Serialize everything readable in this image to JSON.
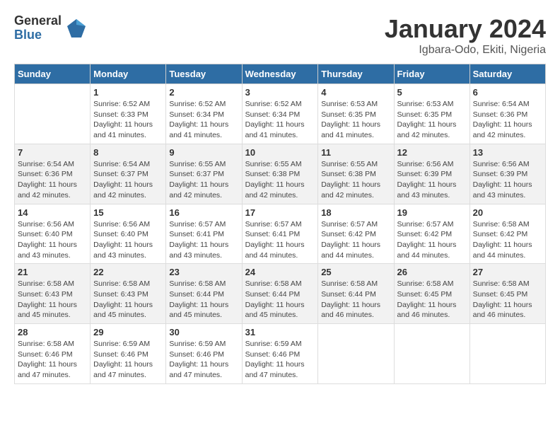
{
  "logo": {
    "general": "General",
    "blue": "Blue"
  },
  "title": "January 2024",
  "subtitle": "Igbara-Odo, Ekiti, Nigeria",
  "days_header": [
    "Sunday",
    "Monday",
    "Tuesday",
    "Wednesday",
    "Thursday",
    "Friday",
    "Saturday"
  ],
  "weeks": [
    [
      {
        "day": "",
        "sunrise": "",
        "sunset": "",
        "daylight": ""
      },
      {
        "day": "1",
        "sunrise": "Sunrise: 6:52 AM",
        "sunset": "Sunset: 6:33 PM",
        "daylight": "Daylight: 11 hours and 41 minutes."
      },
      {
        "day": "2",
        "sunrise": "Sunrise: 6:52 AM",
        "sunset": "Sunset: 6:34 PM",
        "daylight": "Daylight: 11 hours and 41 minutes."
      },
      {
        "day": "3",
        "sunrise": "Sunrise: 6:52 AM",
        "sunset": "Sunset: 6:34 PM",
        "daylight": "Daylight: 11 hours and 41 minutes."
      },
      {
        "day": "4",
        "sunrise": "Sunrise: 6:53 AM",
        "sunset": "Sunset: 6:35 PM",
        "daylight": "Daylight: 11 hours and 41 minutes."
      },
      {
        "day": "5",
        "sunrise": "Sunrise: 6:53 AM",
        "sunset": "Sunset: 6:35 PM",
        "daylight": "Daylight: 11 hours and 42 minutes."
      },
      {
        "day": "6",
        "sunrise": "Sunrise: 6:54 AM",
        "sunset": "Sunset: 6:36 PM",
        "daylight": "Daylight: 11 hours and 42 minutes."
      }
    ],
    [
      {
        "day": "7",
        "sunrise": "Sunrise: 6:54 AM",
        "sunset": "Sunset: 6:36 PM",
        "daylight": "Daylight: 11 hours and 42 minutes."
      },
      {
        "day": "8",
        "sunrise": "Sunrise: 6:54 AM",
        "sunset": "Sunset: 6:37 PM",
        "daylight": "Daylight: 11 hours and 42 minutes."
      },
      {
        "day": "9",
        "sunrise": "Sunrise: 6:55 AM",
        "sunset": "Sunset: 6:37 PM",
        "daylight": "Daylight: 11 hours and 42 minutes."
      },
      {
        "day": "10",
        "sunrise": "Sunrise: 6:55 AM",
        "sunset": "Sunset: 6:38 PM",
        "daylight": "Daylight: 11 hours and 42 minutes."
      },
      {
        "day": "11",
        "sunrise": "Sunrise: 6:55 AM",
        "sunset": "Sunset: 6:38 PM",
        "daylight": "Daylight: 11 hours and 42 minutes."
      },
      {
        "day": "12",
        "sunrise": "Sunrise: 6:56 AM",
        "sunset": "Sunset: 6:39 PM",
        "daylight": "Daylight: 11 hours and 43 minutes."
      },
      {
        "day": "13",
        "sunrise": "Sunrise: 6:56 AM",
        "sunset": "Sunset: 6:39 PM",
        "daylight": "Daylight: 11 hours and 43 minutes."
      }
    ],
    [
      {
        "day": "14",
        "sunrise": "Sunrise: 6:56 AM",
        "sunset": "Sunset: 6:40 PM",
        "daylight": "Daylight: 11 hours and 43 minutes."
      },
      {
        "day": "15",
        "sunrise": "Sunrise: 6:56 AM",
        "sunset": "Sunset: 6:40 PM",
        "daylight": "Daylight: 11 hours and 43 minutes."
      },
      {
        "day": "16",
        "sunrise": "Sunrise: 6:57 AM",
        "sunset": "Sunset: 6:41 PM",
        "daylight": "Daylight: 11 hours and 43 minutes."
      },
      {
        "day": "17",
        "sunrise": "Sunrise: 6:57 AM",
        "sunset": "Sunset: 6:41 PM",
        "daylight": "Daylight: 11 hours and 44 minutes."
      },
      {
        "day": "18",
        "sunrise": "Sunrise: 6:57 AM",
        "sunset": "Sunset: 6:42 PM",
        "daylight": "Daylight: 11 hours and 44 minutes."
      },
      {
        "day": "19",
        "sunrise": "Sunrise: 6:57 AM",
        "sunset": "Sunset: 6:42 PM",
        "daylight": "Daylight: 11 hours and 44 minutes."
      },
      {
        "day": "20",
        "sunrise": "Sunrise: 6:58 AM",
        "sunset": "Sunset: 6:42 PM",
        "daylight": "Daylight: 11 hours and 44 minutes."
      }
    ],
    [
      {
        "day": "21",
        "sunrise": "Sunrise: 6:58 AM",
        "sunset": "Sunset: 6:43 PM",
        "daylight": "Daylight: 11 hours and 45 minutes."
      },
      {
        "day": "22",
        "sunrise": "Sunrise: 6:58 AM",
        "sunset": "Sunset: 6:43 PM",
        "daylight": "Daylight: 11 hours and 45 minutes."
      },
      {
        "day": "23",
        "sunrise": "Sunrise: 6:58 AM",
        "sunset": "Sunset: 6:44 PM",
        "daylight": "Daylight: 11 hours and 45 minutes."
      },
      {
        "day": "24",
        "sunrise": "Sunrise: 6:58 AM",
        "sunset": "Sunset: 6:44 PM",
        "daylight": "Daylight: 11 hours and 45 minutes."
      },
      {
        "day": "25",
        "sunrise": "Sunrise: 6:58 AM",
        "sunset": "Sunset: 6:44 PM",
        "daylight": "Daylight: 11 hours and 46 minutes."
      },
      {
        "day": "26",
        "sunrise": "Sunrise: 6:58 AM",
        "sunset": "Sunset: 6:45 PM",
        "daylight": "Daylight: 11 hours and 46 minutes."
      },
      {
        "day": "27",
        "sunrise": "Sunrise: 6:58 AM",
        "sunset": "Sunset: 6:45 PM",
        "daylight": "Daylight: 11 hours and 46 minutes."
      }
    ],
    [
      {
        "day": "28",
        "sunrise": "Sunrise: 6:58 AM",
        "sunset": "Sunset: 6:46 PM",
        "daylight": "Daylight: 11 hours and 47 minutes."
      },
      {
        "day": "29",
        "sunrise": "Sunrise: 6:59 AM",
        "sunset": "Sunset: 6:46 PM",
        "daylight": "Daylight: 11 hours and 47 minutes."
      },
      {
        "day": "30",
        "sunrise": "Sunrise: 6:59 AM",
        "sunset": "Sunset: 6:46 PM",
        "daylight": "Daylight: 11 hours and 47 minutes."
      },
      {
        "day": "31",
        "sunrise": "Sunrise: 6:59 AM",
        "sunset": "Sunset: 6:46 PM",
        "daylight": "Daylight: 11 hours and 47 minutes."
      },
      {
        "day": "",
        "sunrise": "",
        "sunset": "",
        "daylight": ""
      },
      {
        "day": "",
        "sunrise": "",
        "sunset": "",
        "daylight": ""
      },
      {
        "day": "",
        "sunrise": "",
        "sunset": "",
        "daylight": ""
      }
    ]
  ]
}
